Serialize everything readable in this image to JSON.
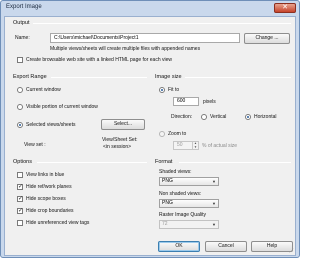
{
  "window": {
    "title": "Export Image",
    "close_glyph": "✕"
  },
  "output": {
    "group_title": "Output",
    "name_label": "Name:",
    "name_value": "C:\\Users\\michael\\Documents\\Project1",
    "change_button": "Change ...",
    "note": "Multiple views/sheets will create multiple files with appended names",
    "browsable_checkbox": "Create browsable web site with a linked HTML page for each view",
    "browsable_checked": false
  },
  "export_range": {
    "group_title": "Export Range",
    "current_window": "Current window",
    "visible_portion": "Visible portion of current window",
    "selected_views": "Selected views/sheets",
    "selected_option": "selected_views",
    "select_button": "Select...",
    "view_set_label": "View set :",
    "view_sheet_set_label": "View/Sheet Set:",
    "view_sheet_set_value": "<in session>"
  },
  "image_size": {
    "group_title": "Image size",
    "fit_to_label": "Fit to",
    "pixels_value": "600",
    "pixels_label": "pixels",
    "direction_label": "Direction:",
    "vertical_label": "Vertical",
    "horizontal_label": "Horizontal",
    "direction_selected": "horizontal",
    "zoom_to_label": "Zoom to",
    "zoom_value": "50",
    "zoom_suffix": "% of actual size",
    "size_mode": "fit_to"
  },
  "options": {
    "group_title": "Options",
    "items": [
      {
        "label": "View links in blue",
        "checked": false
      },
      {
        "label": "Hide ref/work planes",
        "checked": true
      },
      {
        "label": "Hide scope boxes",
        "checked": true
      },
      {
        "label": "Hide crop boundaries",
        "checked": true
      },
      {
        "label": "Hide unreferenced view tags",
        "checked": false
      }
    ]
  },
  "format": {
    "group_title": "Format",
    "shaded_label": "Shaded views:",
    "shaded_value": "PNG",
    "non_shaded_label": "Non shaded views:",
    "non_shaded_value": "PNG",
    "raster_label": "Raster Image Quality",
    "raster_value": "72"
  },
  "footer": {
    "ok_button": "OK",
    "cancel_button": "Cancel",
    "help_button": "Help"
  }
}
